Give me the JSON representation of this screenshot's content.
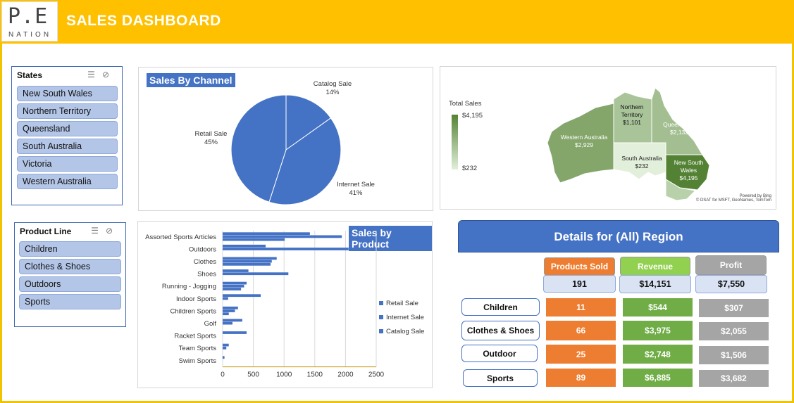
{
  "header": {
    "logo_big": "P.E",
    "logo_small": "NATION",
    "title": "SALES DASHBOARD"
  },
  "states_slicer": {
    "title": "States",
    "items": [
      "New South Wales",
      "Northern Territory",
      "Queensland",
      "South Australia",
      "Victoria",
      "Western Australia"
    ]
  },
  "product_slicer": {
    "title": "Product Line",
    "items": [
      "Children",
      "Clothes & Shoes",
      "Outdoors",
      "Sports"
    ]
  },
  "channel_chart": {
    "title": "Sales By Channel",
    "slices": [
      {
        "name": "Catalog Sale",
        "pct": "14%"
      },
      {
        "name": "Internet Sale",
        "pct": "41%"
      },
      {
        "name": "Retail Sale",
        "pct": "45%"
      }
    ]
  },
  "map": {
    "legend_title": "Total Sales",
    "legend_max": "$4,195",
    "legend_min": "$232",
    "regions": [
      {
        "name": "Western Australia",
        "value": "$2,929"
      },
      {
        "name": "Northern Territory",
        "value": "$1,101"
      },
      {
        "name": "Queensland",
        "value": "$2,132"
      },
      {
        "name": "South Australia",
        "value": "$232"
      },
      {
        "name": "New South Wales",
        "value": "$4,195"
      }
    ],
    "credit1": "Powered by Bing",
    "credit2": "© DSAT for MSFT, GeoNames, TomTom"
  },
  "chart_data": {
    "type": "bar",
    "title": "Sales by Product",
    "categories": [
      "Assorted Sports Articles",
      "Outdoors",
      "Clothes",
      "Shoes",
      "Running - Jogging",
      "Indoor Sports",
      "Children Sports",
      "Golf",
      "Racket Sports",
      "Team Sports",
      "Swim Sports"
    ],
    "series": [
      {
        "name": "Retail Sale",
        "values": [
          1420,
          700,
          880,
          420,
          390,
          620,
          250,
          320,
          390,
          100,
          30
        ]
      },
      {
        "name": "Internet Sale",
        "values": [
          1940,
          2050,
          800,
          1070,
          350,
          90,
          200,
          160,
          0,
          60,
          0
        ]
      },
      {
        "name": "Catalog Sale",
        "values": [
          1010,
          0,
          780,
          0,
          300,
          0,
          100,
          0,
          0,
          0,
          0
        ]
      }
    ],
    "xticks": [
      "0",
      "500",
      "1000",
      "1500",
      "2000",
      "2500"
    ],
    "xlim": [
      0,
      2500
    ],
    "legend": "right"
  },
  "details": {
    "title": "Details for (All) Region",
    "headers": [
      "Products Sold",
      "Revenue",
      "Profit"
    ],
    "totals": [
      "191",
      "$14,151",
      "$7,550"
    ],
    "rows": [
      {
        "label": "Children",
        "sold": "11",
        "revenue": "$544",
        "profit": "$307"
      },
      {
        "label": "Clothes & Shoes",
        "sold": "66",
        "revenue": "$3,975",
        "profit": "$2,055"
      },
      {
        "label": "Outdoor",
        "sold": "25",
        "revenue": "$2,748",
        "profit": "$1,506"
      },
      {
        "label": "Sports",
        "sold": "89",
        "revenue": "$6,885",
        "profit": "$3,682"
      }
    ]
  },
  "colors": {
    "accent": "#ffc000",
    "blue": "#4472c4",
    "orange": "#ed7d31",
    "green": "#70ad47",
    "grey": "#a5a5a5"
  }
}
